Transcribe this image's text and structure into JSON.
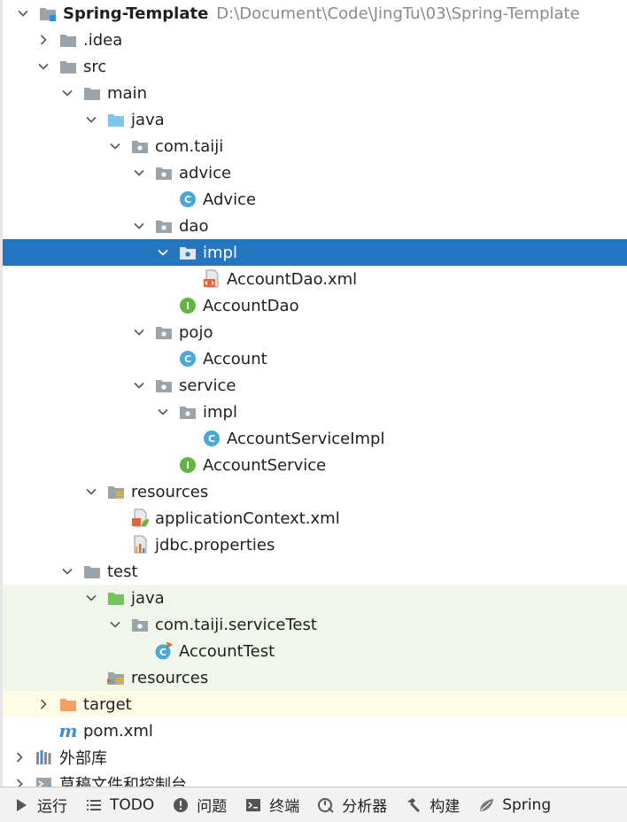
{
  "project": {
    "name": "Spring-Template",
    "path": "D:\\Document\\Code\\JingTu\\03\\Spring-Template"
  },
  "tree": {
    "idea": ".idea",
    "src": "src",
    "main": "main",
    "main_java": "java",
    "com_taiji": "com.taiji",
    "advice": "advice",
    "advice_class": "Advice",
    "dao": "dao",
    "dao_impl": "impl",
    "account_dao_xml": "AccountDao.xml",
    "account_dao": "AccountDao",
    "pojo": "pojo",
    "account": "Account",
    "service": "service",
    "service_impl": "impl",
    "account_service_impl": "AccountServiceImpl",
    "account_service": "AccountService",
    "main_resources": "resources",
    "application_context": "applicationContext.xml",
    "jdbc_properties": "jdbc.properties",
    "test": "test",
    "test_java": "java",
    "service_test_pkg": "com.taiji.serviceTest",
    "account_test": "AccountTest",
    "test_resources": "resources",
    "target": "target",
    "pom": "pom.xml",
    "external_libs": "外部库",
    "scratches": "草稿文件和控制台"
  },
  "toolbar": {
    "run": "运行",
    "todo": "TODO",
    "problems": "问题",
    "terminal": "终端",
    "profiler": "分析器",
    "build": "构建",
    "spring": "Spring"
  },
  "icons": {
    "folder": "folder-icon",
    "package": "package-icon",
    "class": "class-icon",
    "interface": "interface-icon"
  },
  "colors": {
    "selection": "#2675bf",
    "test_background": "#f0f7ea",
    "excluded_background": "#fdfbe6",
    "source_folder": "#7ec7e8",
    "test_folder": "#74c35f",
    "excluded_folder": "#f2a064"
  },
  "selected_item": "dao.impl"
}
